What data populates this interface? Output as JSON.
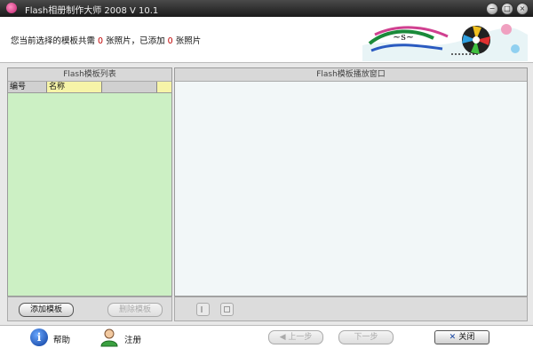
{
  "window": {
    "title": "Flash相册制作大师 2008 V 10.1",
    "min_symbol": "−",
    "max_symbol": "□",
    "close_symbol": "×"
  },
  "summary": {
    "prefix": "您当前选择的模板共需",
    "required_count": "0",
    "middle": "张照片，已添加",
    "added_count": "0",
    "suffix": "张照片"
  },
  "template_list": {
    "title": "Flash模板列表",
    "columns": [
      "编号",
      "名称"
    ],
    "add_button": "添加模板",
    "delete_button": "删除模板"
  },
  "preview": {
    "title": "Flash模板播放窗口"
  },
  "footer": {
    "help_label": "帮助",
    "register_label": "注册",
    "prev_button": "上一步",
    "next_button": "下一步",
    "close_button": "关闭"
  },
  "colors": {
    "list_bg": "#ccf0c4",
    "preview_bg": "#f2f7f8",
    "count_red": "#c00000"
  }
}
